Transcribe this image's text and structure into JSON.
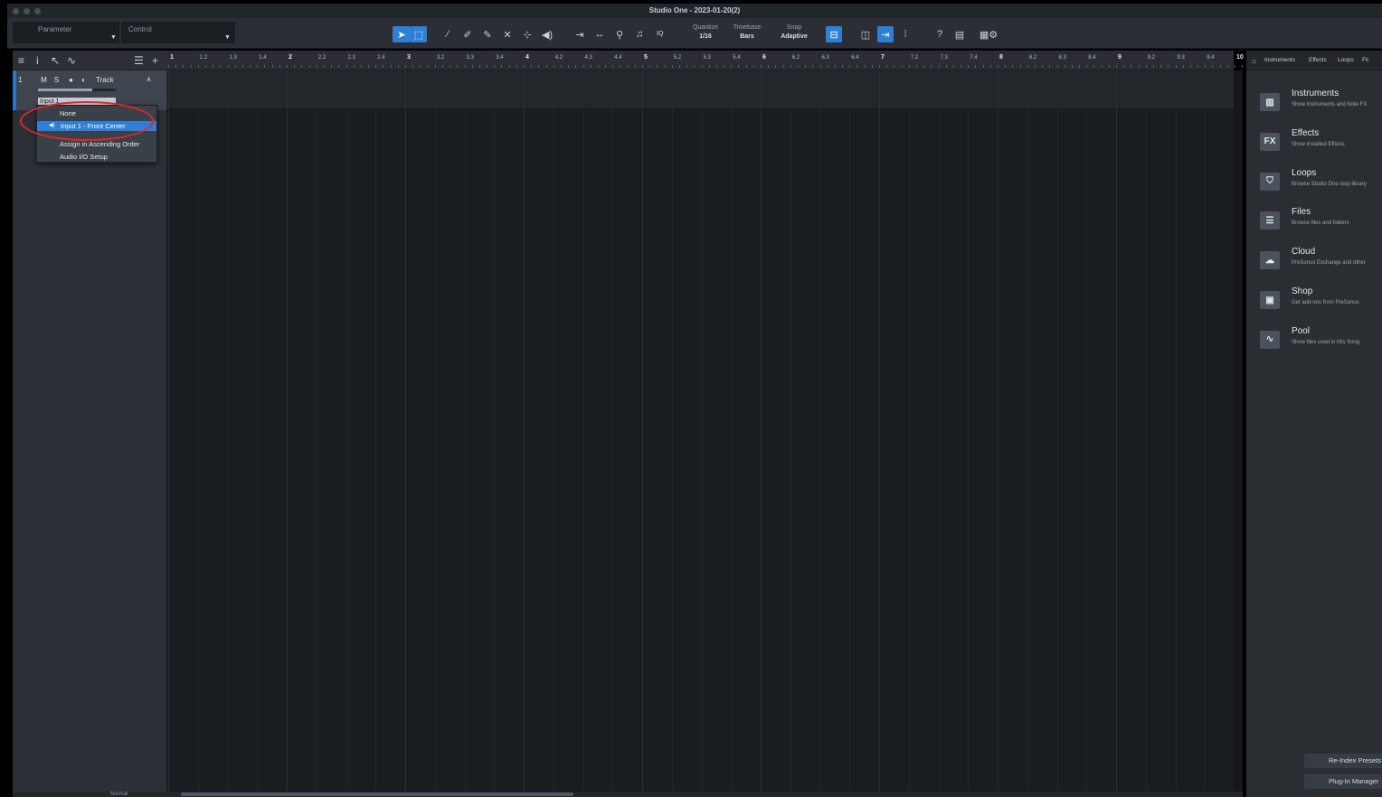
{
  "window": {
    "title": "Studio One - 2023-01-20(2)"
  },
  "toolbar": {
    "parameter_label": "Parameter",
    "control_label": "Control",
    "iq_label": "IQ",
    "quantize": {
      "label": "Quantize",
      "value": "1/16"
    },
    "timebase": {
      "label": "Timebase",
      "value": "Bars"
    },
    "snap": {
      "label": "Snap",
      "value": "Adaptive"
    },
    "help_label": "?"
  },
  "track": {
    "number": "1",
    "mute": "M",
    "solo": "S",
    "name": "Track",
    "input_value": "Input 1"
  },
  "input_menu": {
    "items": [
      {
        "label": "None"
      },
      {
        "label": "Input 1 - Front Center",
        "selected": true
      },
      {
        "label": "Assign in Ascending Order"
      },
      {
        "label": "Audio I/O Setup"
      }
    ]
  },
  "ruler": {
    "labels": [
      "1",
      "1.2",
      "1.3",
      "1.4",
      "2",
      "2.2",
      "2.3",
      "2.4",
      "3",
      "3.2",
      "3.3",
      "3.4",
      "4",
      "4.2",
      "4.3",
      "4.4",
      "5",
      "5.2",
      "5.3",
      "5.4",
      "6",
      "6.2",
      "6.3",
      "6.4",
      "7",
      "7.2",
      "7.3",
      "7.4",
      "8",
      "8.2",
      "8.3",
      "8.4",
      "9",
      "9.2",
      "9.3",
      "9.4",
      "10"
    ]
  },
  "browser": {
    "tabs": [
      "Instruments",
      "Effects",
      "Loops",
      "Fil"
    ],
    "items": [
      {
        "icon": "piano-icon",
        "glyph": "▥",
        "title": "Instruments",
        "desc": "Show Instruments and Note FX"
      },
      {
        "icon": "fx-icon",
        "glyph": "FX",
        "title": "Effects",
        "desc": "Show installed Effects"
      },
      {
        "icon": "loops-icon",
        "glyph": "⛉",
        "title": "Loops",
        "desc": "Browse Studio One loop library"
      },
      {
        "icon": "files-icon",
        "glyph": "☰",
        "title": "Files",
        "desc": "Browse files and folders"
      },
      {
        "icon": "cloud-icon",
        "glyph": "☁",
        "title": "Cloud",
        "desc": "PreSonus Exchange and other"
      },
      {
        "icon": "shop-icon",
        "glyph": "▣",
        "title": "Shop",
        "desc": "Get add-ons from PreSonus"
      },
      {
        "icon": "pool-icon",
        "glyph": "∿",
        "title": "Pool",
        "desc": "Show files used in this Song"
      }
    ],
    "reindex_label": "Re-Index Presets",
    "plugin_manager_label": "Plug-In Manager"
  },
  "footer": {
    "left_text": "Normal"
  },
  "colors": {
    "accent": "#2f7fd6",
    "annotation": "#e0262a"
  }
}
